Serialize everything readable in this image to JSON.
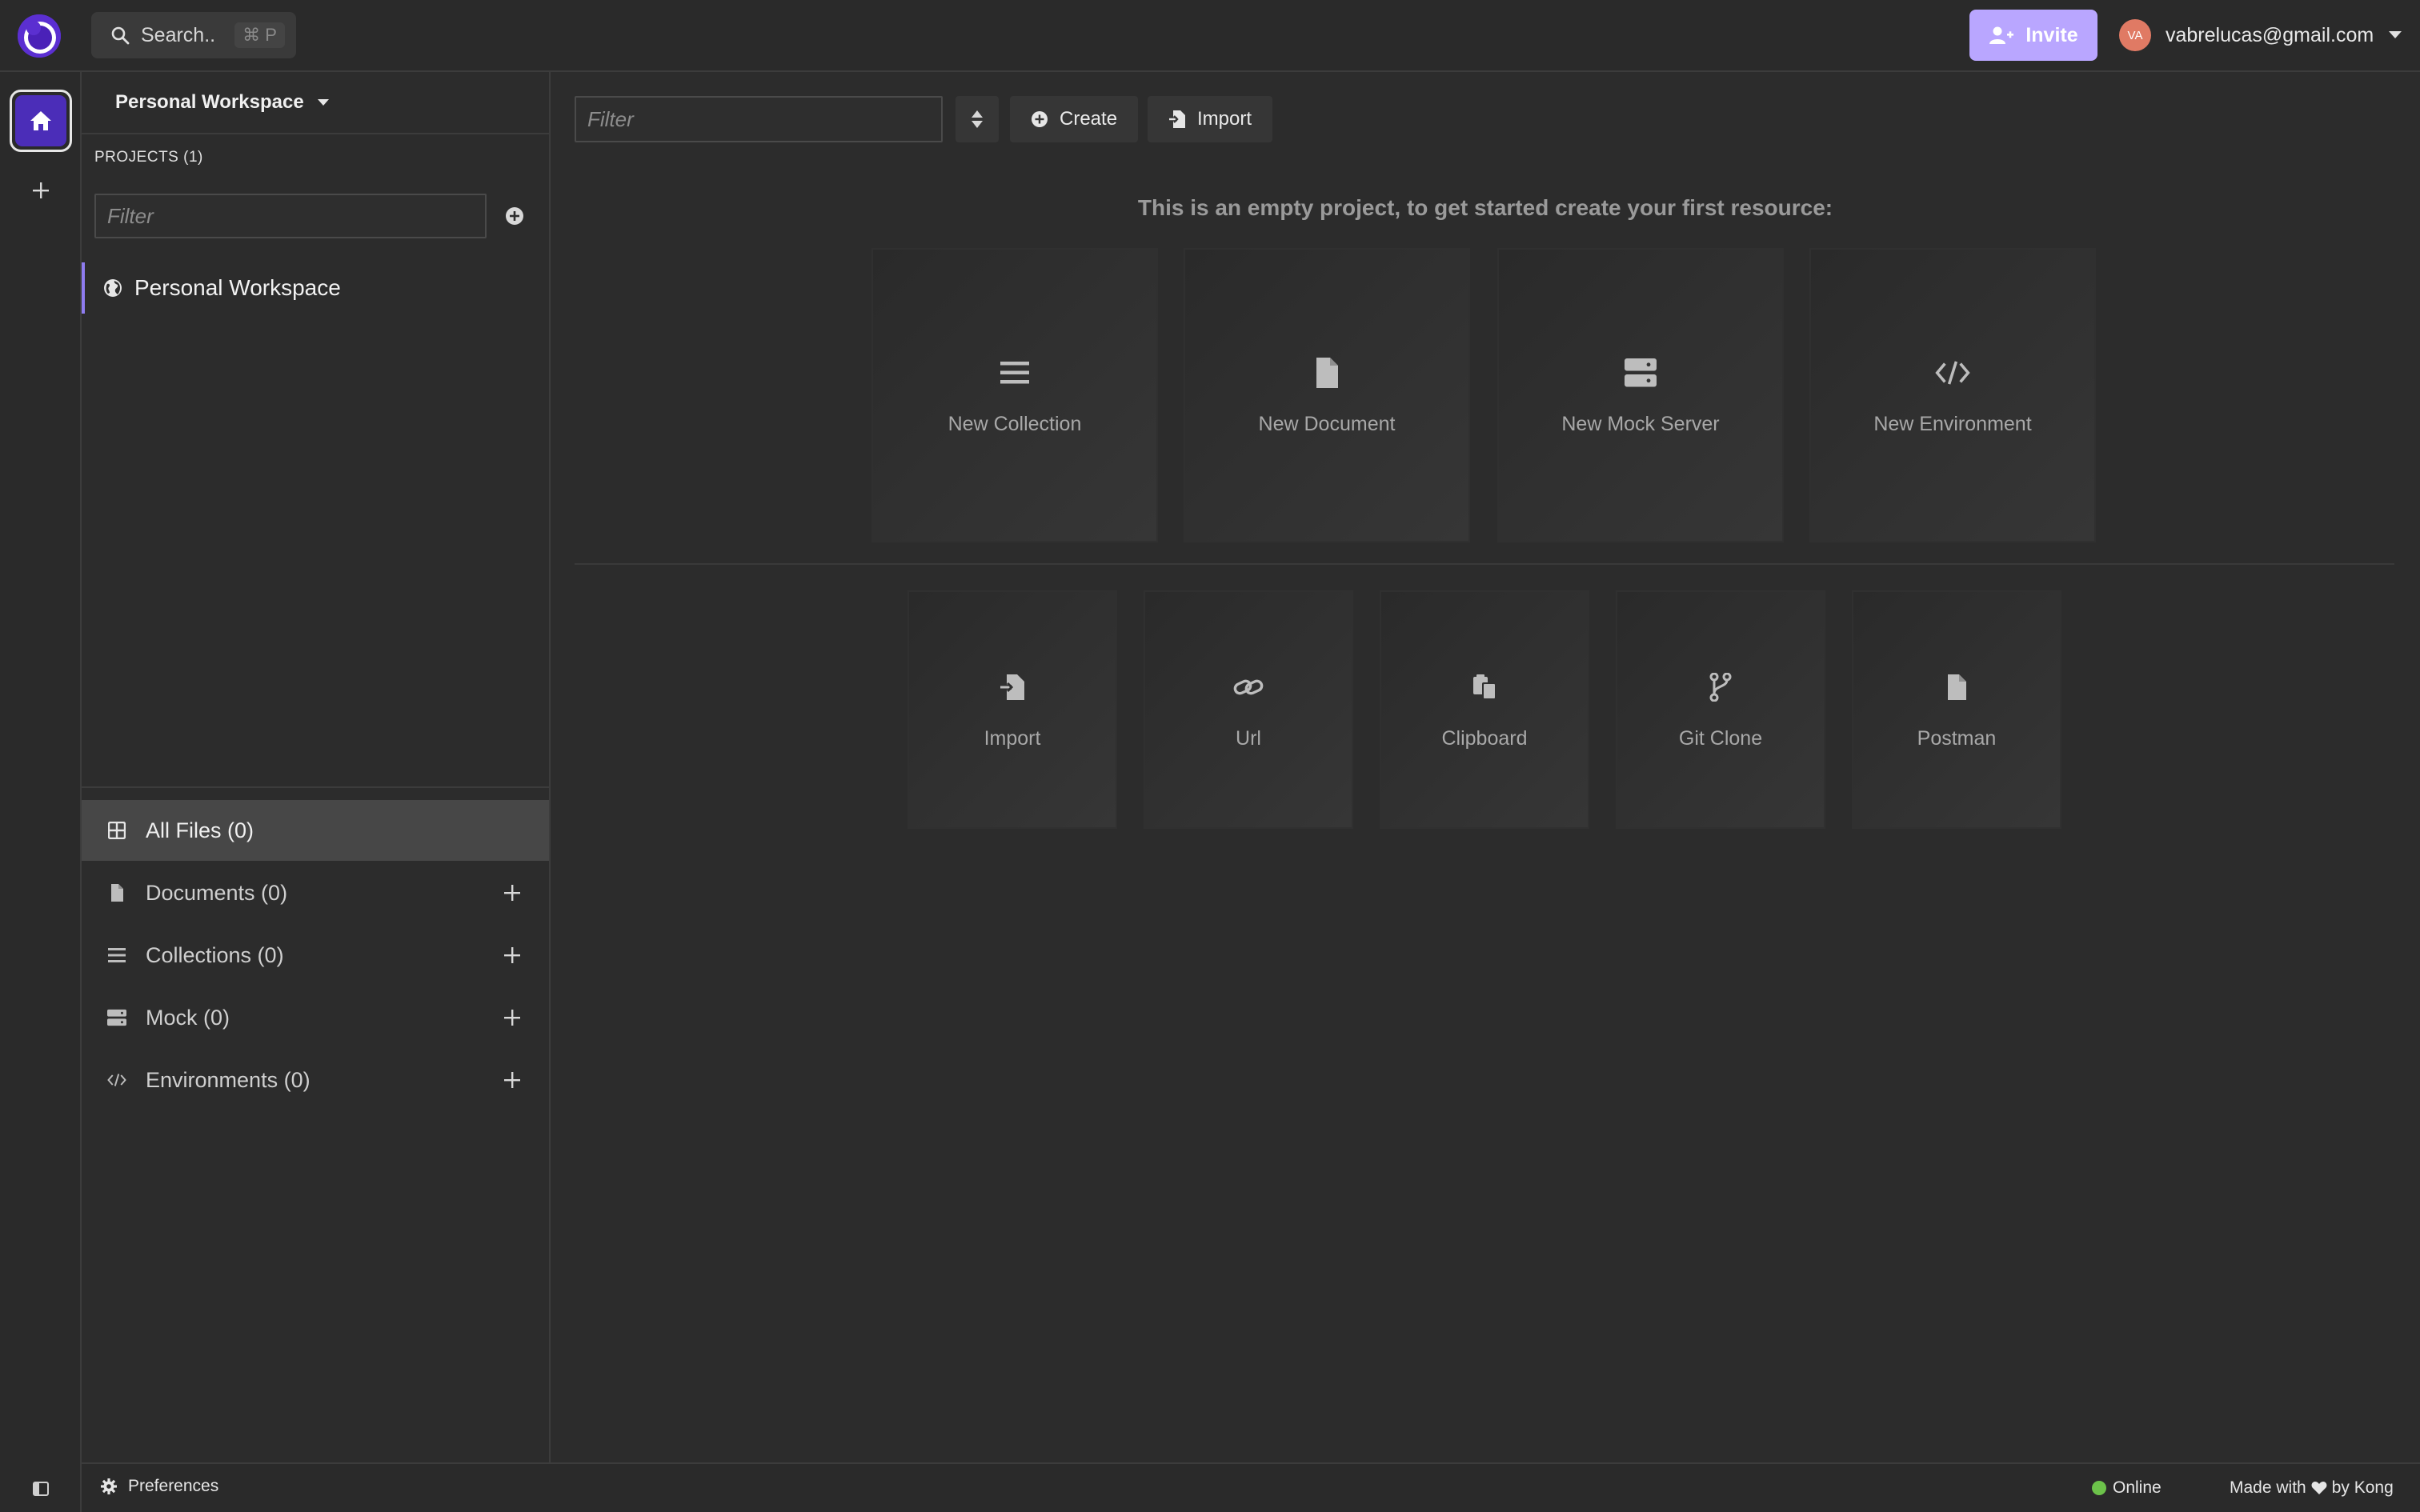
{
  "topbar": {
    "search_label": "Search..",
    "search_shortcut": "⌘ P",
    "invite_label": "Invite",
    "avatar_initials": "VA",
    "user_email": "vabrelucas@gmail.com"
  },
  "sidebar": {
    "workspace_name": "Personal Workspace",
    "projects_label": "PROJECTS (1)",
    "project_filter_placeholder": "Filter",
    "projects": [
      {
        "name": "Personal Workspace",
        "icon": "globe-icon",
        "selected": true
      }
    ],
    "file_nav": [
      {
        "label": "All Files (0)",
        "icon": "grid-icon",
        "active": true
      },
      {
        "label": "Documents (0)",
        "icon": "document-icon"
      },
      {
        "label": "Collections (0)",
        "icon": "list-icon"
      },
      {
        "label": "Mock (0)",
        "icon": "server-icon"
      },
      {
        "label": "Environments (0)",
        "icon": "code-icon"
      }
    ]
  },
  "main": {
    "filter_placeholder": "Filter",
    "create_label": "Create",
    "import_label": "Import",
    "empty_message": "This is an empty project, to get started create your first resource:",
    "create_cards": [
      {
        "label": "New Collection",
        "icon": "list-icon"
      },
      {
        "label": "New Document",
        "icon": "document-icon"
      },
      {
        "label": "New Mock Server",
        "icon": "server-icon"
      },
      {
        "label": "New Environment",
        "icon": "code-icon"
      }
    ],
    "import_cards": [
      {
        "label": "Import",
        "icon": "file-import-icon"
      },
      {
        "label": "Url",
        "icon": "link-icon"
      },
      {
        "label": "Clipboard",
        "icon": "clipboard-icon"
      },
      {
        "label": "Git Clone",
        "icon": "git-branch-icon"
      },
      {
        "label": "Postman",
        "icon": "document-icon"
      }
    ]
  },
  "statusbar": {
    "preferences_label": "Preferences",
    "online_label": "Online",
    "made_with_prefix": "Made with",
    "made_with_suffix": "by Kong"
  },
  "colors": {
    "accent": "#8f7cf0",
    "invite_bg": "#b9a6ff",
    "logo": "#5b2fd1",
    "online": "#6cc24a",
    "background": "#2c2c2c"
  }
}
